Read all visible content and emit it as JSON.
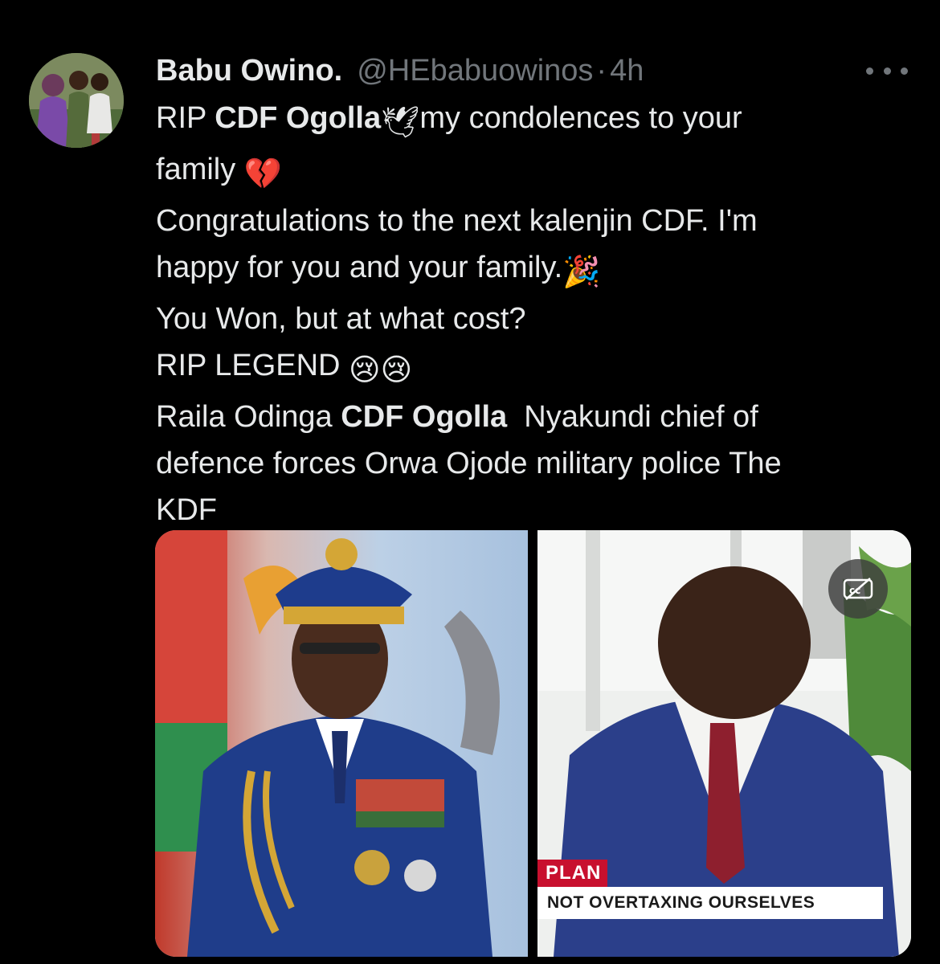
{
  "tweet": {
    "display_name": "Babu Owino.",
    "handle": "@HEbabuowinos",
    "separator": "·",
    "time": "4h",
    "more_icon": "ellipsis-icon",
    "text": {
      "rip": "RIP ",
      "cdf_ogolla_1": "CDF Ogolla",
      "dove_emoji": "🕊",
      "condolences": "my condolences to your",
      "family": "family ",
      "broken_heart_emoji": "💔",
      "congrats": "Congratulations to the next kalenjin CDF. I'm",
      "happy": "happy for you and your family.",
      "party_emoji": "🎉",
      "you_won": "You Won, but at what cost?",
      "rip_legend": "RIP LEGEND ",
      "cry_emoji": "😢😢",
      "raila": "Raila Odinga ",
      "cdf_ogolla_2": "CDF Ogolla",
      "nyakundi": "  Nyakundi chief of",
      "defence": "defence forces Orwa Ojode military police The",
      "kdf": "KDF"
    },
    "media": {
      "left_image": "photo of general in blue uniform",
      "right_video": {
        "ticker_tag": "PLAN",
        "ticker_text": "NOT OVERTAXING OURSELVES",
        "cc_icon": "closed-captions-icon"
      }
    }
  },
  "colors": {
    "background": "#000000",
    "text": "#e7e9ea",
    "muted": "#71767b"
  }
}
